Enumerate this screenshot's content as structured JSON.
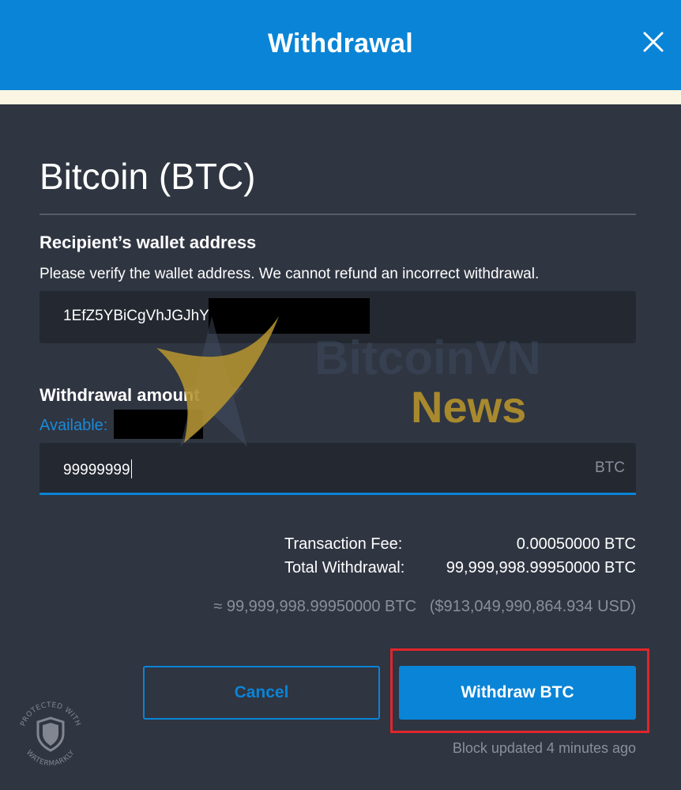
{
  "dialog": {
    "title": "Withdrawal",
    "close_icon": "close-icon"
  },
  "coin": {
    "title": "Bitcoin (BTC)"
  },
  "recipient": {
    "label": "Recipient’s wallet address",
    "hint": "Please verify the wallet address. We cannot refund an incorrect withdrawal.",
    "address_value": "1EfZ5YBiCgVhJGJhY"
  },
  "amount": {
    "label": "Withdrawal amount",
    "available_label": "Available:",
    "value": "99999999",
    "unit": "BTC"
  },
  "summary": {
    "fee_label": "Transaction Fee:",
    "fee_value": "0.00050000 BTC",
    "total_label": "Total Withdrawal:",
    "total_value": "99,999,998.99950000 BTC",
    "approx_btc": "≈ 99,999,998.99950000 BTC",
    "approx_usd": "($913,049,990,864.934 USD)"
  },
  "buttons": {
    "cancel_label": "Cancel",
    "withdraw_label": "Withdraw BTC"
  },
  "status": {
    "block_updated": "Block updated 4 minutes ago"
  },
  "watermark": {
    "brand_line_1": "BitcoinVN",
    "brand_line_2": "News",
    "badge_top": "PROTECTED WITH",
    "badge_bottom": "WATERMARKLY"
  },
  "colors": {
    "header": "#0a84d6",
    "panel": "#2f3541",
    "field": "#232831",
    "accent": "#0a84d6",
    "highlight": "#e0252b"
  }
}
